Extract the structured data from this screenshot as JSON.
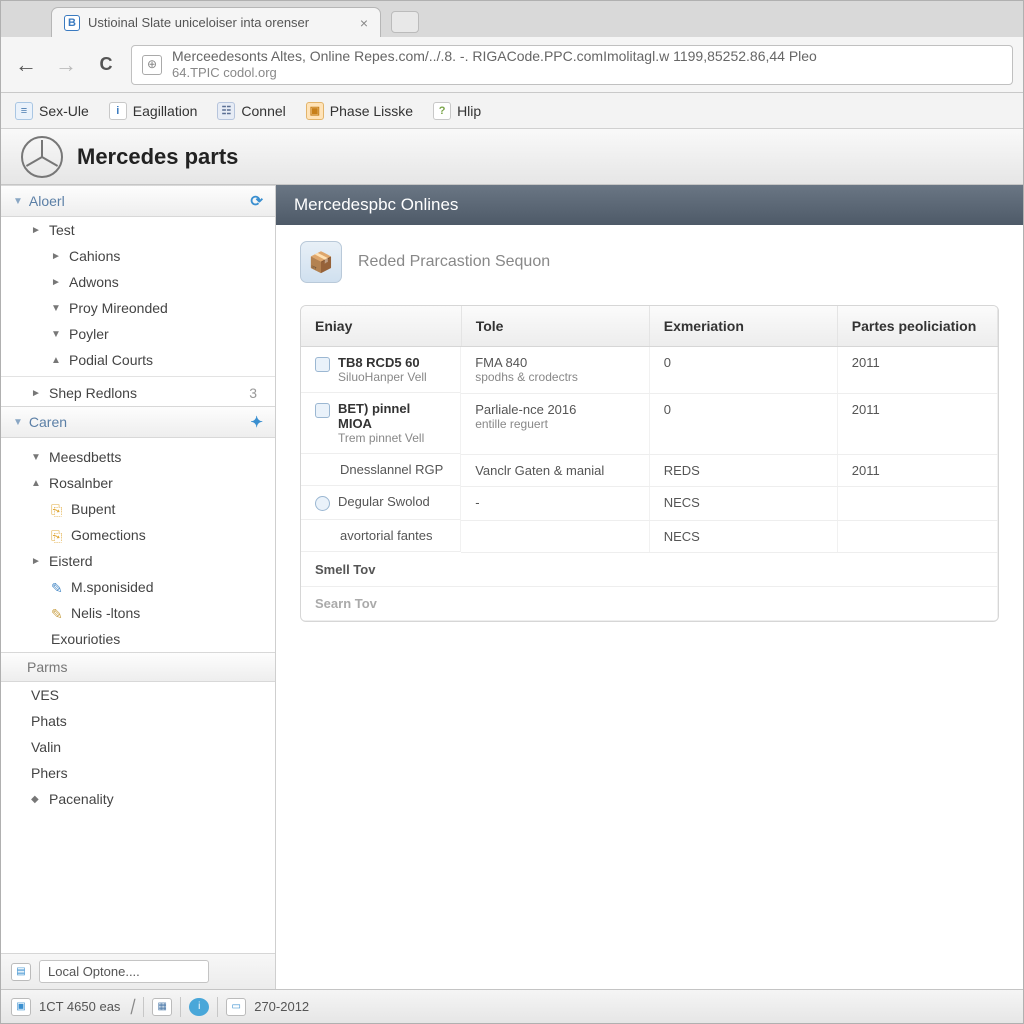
{
  "browser": {
    "tab_title": "Ustioinal Slate uniceloiser inta orenser",
    "address_line1": "Merceedesonts Altes, Online Repes.com/../.8. -. RIGACode.PPC.comImolitagl.w 1199,85252.86,44 Pleo",
    "address_line2": "64.TPIC codol.org"
  },
  "bookmarks": [
    {
      "label": "Sex-Ule"
    },
    {
      "label": "Eagillation"
    },
    {
      "label": "Connel"
    },
    {
      "label": "Phase Lisske"
    },
    {
      "label": "Hlip"
    }
  ],
  "app_title": "Mercedes parts",
  "sidebar": {
    "section1": {
      "title": "Aloerl",
      "items": [
        {
          "icon": "►",
          "label": "Test"
        },
        {
          "icon": "►",
          "label": "Cahions"
        },
        {
          "icon": "►",
          "label": "Adwons"
        },
        {
          "icon": "▼",
          "label": "Proy Mireonded"
        },
        {
          "icon": "▼",
          "label": "Poyler"
        },
        {
          "icon": "▲",
          "label": "Podial Courts"
        }
      ],
      "shep": {
        "icon": "►",
        "label": "Shep Redlons",
        "badge": "3"
      }
    },
    "section2": {
      "title": "Caren",
      "groups": [
        {
          "items": [
            {
              "icon": "▼",
              "label": "Meesdbetts"
            },
            {
              "icon": "▲",
              "label": "Rosalnber"
            }
          ],
          "subs": [
            {
              "label": "Bupent"
            },
            {
              "label": "Gomections"
            }
          ]
        },
        {
          "items": [
            {
              "icon": "►",
              "label": "Eisterd"
            }
          ],
          "subs": [
            {
              "label": "M.sponisided"
            },
            {
              "label": "Nelis -ltons"
            },
            {
              "label": "Exourioties"
            }
          ]
        }
      ]
    },
    "section3": {
      "title": "Parms",
      "items": [
        {
          "label": "VES"
        },
        {
          "label": "Phats"
        },
        {
          "label": "Valin"
        },
        {
          "label": "Phers"
        },
        {
          "label": "Pacenality",
          "icon": "◆"
        }
      ]
    }
  },
  "content": {
    "header": "Mercedespbc Onlines",
    "section_title": "Reded Prarcastion Sequon",
    "columns": [
      "Eniay",
      "Tole",
      "Exmeriation",
      "Partes peoliciation"
    ],
    "rows": [
      {
        "c1a": "TB8 RCD5 60",
        "c1b": "SiluoHanper Vell",
        "c2a": "FMA 840",
        "c2b": "spodhs & crodectrs",
        "c3": "0",
        "c4": "2011",
        "ic": "square"
      },
      {
        "c1a": "BET) pinnel MIOA",
        "c1b": "Trem pinnet Vell",
        "c2a": "Parliale-nce 2016",
        "c2b": "entille reguert",
        "c3": "0",
        "c4": "2011",
        "ic": "square"
      },
      {
        "c1a": "Dnesslannel RGP",
        "c1b": "",
        "c2a": "Vanclr Gaten & manial",
        "c2b": "",
        "c3": "REDS",
        "c4": "2011",
        "ic": "none"
      },
      {
        "c1a": "Degular Swolod",
        "c1b": "",
        "c2a": "-",
        "c2b": "",
        "c3": "NECS",
        "c4": "",
        "ic": "radio"
      },
      {
        "c1a": "avortorial fantes",
        "c1b": "",
        "c2a": "",
        "c2b": "",
        "c3": "NECS",
        "c4": "",
        "ic": "none"
      }
    ],
    "footer1": "Smell Tov",
    "footer2": "Searn Tov"
  },
  "status": {
    "left": "1CT 4650 eas",
    "dropdown": "Local Optone....",
    "right": "270-2012"
  },
  "colors": {
    "header_bg": "#565f6c",
    "accent": "#3a8fd0"
  }
}
